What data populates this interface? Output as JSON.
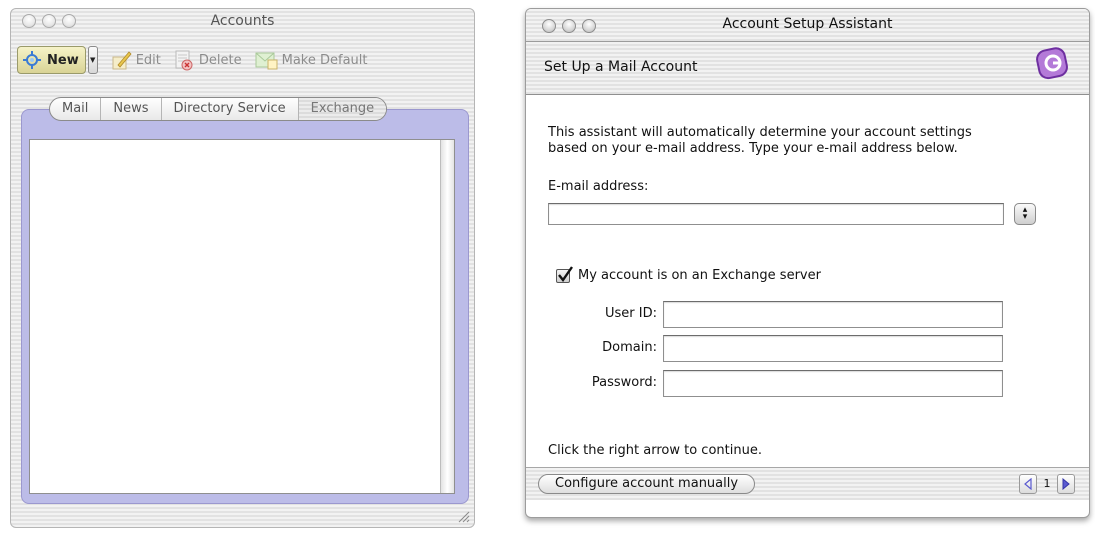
{
  "accounts_window": {
    "title": "Accounts",
    "toolbar": {
      "new_label": "New",
      "edit_label": "Edit",
      "delete_label": "Delete",
      "make_default_label": "Make Default"
    },
    "tabs": [
      {
        "label": "Mail",
        "selected": false
      },
      {
        "label": "News",
        "selected": false
      },
      {
        "label": "Directory Service",
        "selected": false
      },
      {
        "label": "Exchange",
        "selected": true
      }
    ],
    "accounts": []
  },
  "setup_window": {
    "title": "Account Setup Assistant",
    "heading": "Set Up a Mail Account",
    "intro_line1": "This assistant will automatically determine your account settings",
    "intro_line2": "based on your e-mail address. Type your e-mail address below.",
    "email_label": "E-mail address:",
    "email_value": "",
    "exchange_checkbox_label": "My account is on an Exchange server",
    "exchange_checked": true,
    "user_id_label": "User ID:",
    "user_id_value": "",
    "domain_label": "Domain:",
    "domain_value": "",
    "password_label": "Password:",
    "password_value": "",
    "continue_hint": "Click the right arrow to continue.",
    "configure_manually_label": "Configure account manually",
    "page_number": "1"
  },
  "colors": {
    "tab_frame": "#bcbce8",
    "new_button": "#efe9b4",
    "pager_arrow": "#5a5ad0",
    "entourage_icon": "#9b4fc4"
  }
}
